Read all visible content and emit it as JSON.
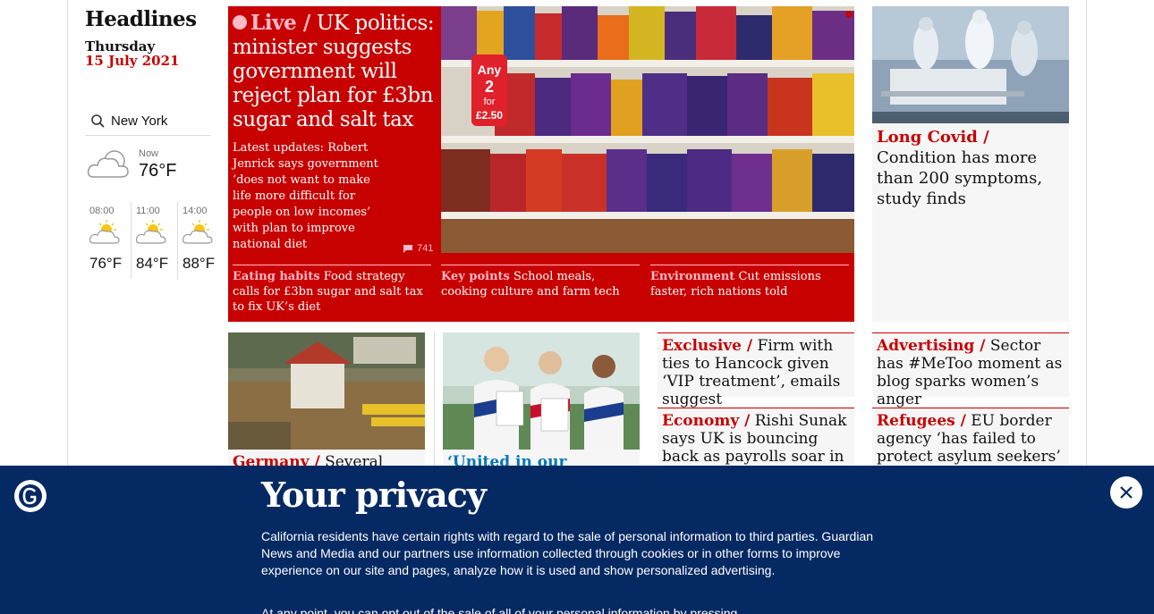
{
  "rail": {
    "title": "Headlines",
    "day": "Thursday",
    "date": "15 July 2021",
    "location": "New York",
    "now_label": "Now",
    "now_temp": "76°F",
    "forecast": [
      {
        "time": "08:00",
        "temp": "76°F"
      },
      {
        "time": "11:00",
        "temp": "84°F"
      },
      {
        "time": "14:00",
        "temp": "88°F"
      }
    ]
  },
  "lead": {
    "kicker": "Live /",
    "headline": "UK politics: minister suggests government will reject plan for £3bn sugar and salt tax",
    "standfirst": "Latest updates: Robert Jenrick says government ‘does not want to make life more difficult for people on low incomes’ with plan to improve national diet",
    "comments": "741",
    "subs": [
      {
        "kicker": "Eating habits",
        "text": "Food strategy calls for £3bn sugar and salt tax to fix UK’s diet"
      },
      {
        "kicker": "Key points",
        "text": "School meals, cooking culture and farm tech"
      },
      {
        "kicker": "Environment",
        "text": "Cut emissions faster, rich nations told"
      }
    ],
    "image_signs": {
      "any": "Any",
      "two": "2",
      "for": "for",
      "price": "£2.50"
    }
  },
  "covid": {
    "kicker": "Long Covid /",
    "headline": "Condition has more than 200 symptoms, study finds"
  },
  "row2": {
    "germany": {
      "kicker": "Germany /",
      "headline": "Several"
    },
    "united": {
      "headline": "‘United in our"
    },
    "exclusive": {
      "kicker": "Exclusive /",
      "headline": "Firm with ties to Hancock given ‘VIP treatment’, emails suggest"
    },
    "economy": {
      "kicker": "Economy /",
      "headline": "Rishi Sunak says UK is bouncing back as payrolls soar in June"
    },
    "advertising": {
      "kicker": "Advertising /",
      "headline": "Sector has #MeToo moment as blog sparks women’s anger"
    },
    "refugees": {
      "kicker": "Refugees /",
      "headline": "EU border agency ‘has failed to protect asylum seekers’"
    }
  },
  "privacy": {
    "title": "Your privacy",
    "p1": "California residents have certain rights with regard to the sale of personal information to third parties. Guardian News and Media and our partners use information collected through cookies or in other forms to improve experience on our site and pages, analyze how it is used and show personalized advertising.",
    "p2": "At any point, you can opt out of the sale of all of your personal information by pressing"
  },
  "colors": {
    "news_red": "#c70000",
    "pink_kicker": "#ffbac8",
    "privacy_blue": "#052962",
    "blue_kicker": "#0077b6"
  },
  "icons": [
    "search-icon",
    "cloud-icon",
    "sun-cloud-icon",
    "comment-icon",
    "guardian-logo",
    "close-icon"
  ]
}
